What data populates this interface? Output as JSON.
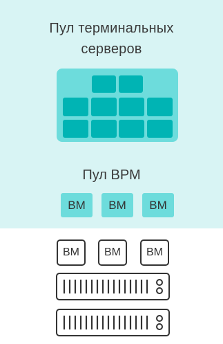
{
  "pool": {
    "title_line1": "Пул терминальных",
    "title_line2": "серверов"
  },
  "vdi_pool": {
    "title": "Пул ВРМ",
    "vms": [
      "ВМ",
      "ВМ",
      "ВМ"
    ]
  },
  "host": {
    "vms": [
      "ВМ",
      "ВМ",
      "ВМ"
    ]
  },
  "colors": {
    "panel": "#d8f4f4",
    "grid": "#6ddcdc",
    "cell": "#00b4b4",
    "stroke": "#333333"
  },
  "icons": [
    "server-rack-icon",
    "server-rack-icon"
  ]
}
